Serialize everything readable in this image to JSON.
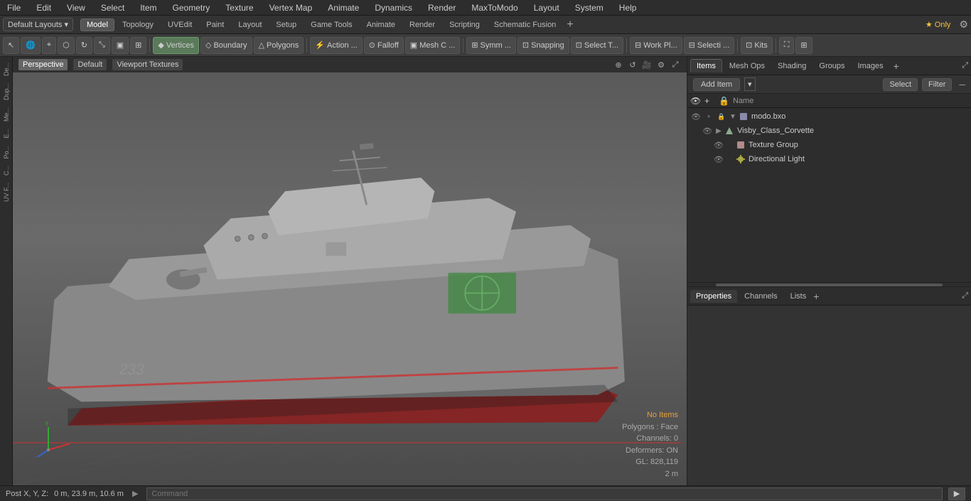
{
  "menu": {
    "items": [
      "File",
      "Edit",
      "View",
      "Select",
      "Item",
      "Geometry",
      "Texture",
      "Vertex Map",
      "Animate",
      "Dynamics",
      "Render",
      "MaxToModo",
      "Layout",
      "System",
      "Help"
    ]
  },
  "layout_bar": {
    "dropdown_label": "Default Layouts ▾",
    "tabs": [
      "Model",
      "Topology",
      "UVEdit",
      "Paint",
      "Layout",
      "Setup",
      "Game Tools",
      "Animate",
      "Render",
      "Scripting",
      "Schematic Fusion"
    ],
    "add_btn": "+",
    "star_label": "★ Only"
  },
  "toolbar": {
    "buttons": [
      {
        "id": "select-mode",
        "label": "",
        "icon": "⊹"
      },
      {
        "id": "action-center",
        "label": "",
        "icon": "⊕"
      },
      {
        "id": "transform-falloff",
        "label": "",
        "icon": "⬡"
      },
      {
        "id": "transform-move",
        "label": "",
        "icon": "✦"
      },
      {
        "id": "transform-rotate",
        "label": "",
        "icon": "↻"
      },
      {
        "id": "transform-scale",
        "label": "",
        "icon": "⤡"
      },
      {
        "id": "transform-type",
        "label": "",
        "icon": "▣"
      },
      {
        "id": "snapping",
        "label": "",
        "icon": "⊞"
      },
      {
        "id": "vertices-btn",
        "label": "Vertices",
        "icon": "◆"
      },
      {
        "id": "boundary-btn",
        "label": "Boundary",
        "icon": "◇"
      },
      {
        "id": "polygons-btn",
        "label": "Polygons",
        "icon": "▲"
      },
      {
        "id": "action-btn",
        "label": "Action ...",
        "icon": "⚡"
      },
      {
        "id": "falloff-btn",
        "label": "Falloff",
        "icon": "⊙"
      },
      {
        "id": "mesh-c-btn",
        "label": "Mesh C ...",
        "icon": "▣"
      },
      {
        "id": "symm-btn",
        "label": "Symm ...",
        "icon": "⊞"
      },
      {
        "id": "snapping-btn",
        "label": "Snapping",
        "icon": "⊡"
      },
      {
        "id": "select-t-btn",
        "label": "Select T...",
        "icon": "⊡"
      },
      {
        "id": "work-pl-btn",
        "label": "Work Pl...",
        "icon": "⊡"
      },
      {
        "id": "selecti-btn",
        "label": "Selecti ...",
        "icon": "⊡"
      },
      {
        "id": "kits-btn",
        "label": "Kits",
        "icon": "⊡"
      },
      {
        "id": "fullscreen-btn",
        "label": "",
        "icon": "⛶"
      },
      {
        "id": "layout-split-btn",
        "label": "",
        "icon": "⊞"
      }
    ]
  },
  "viewport": {
    "tabs": [
      "Perspective",
      "Default",
      "Viewport Textures"
    ],
    "active_tab": "Perspective",
    "status": {
      "no_items": "No Items",
      "polygons": "Polygons : Face",
      "channels": "Channels: 0",
      "deformers": "Deformers: ON",
      "gl": "GL: 828,119",
      "distance": "2 m"
    }
  },
  "left_sidebar": {
    "tabs": [
      "De...",
      "Dup...",
      "Me...",
      "E...",
      "Po...",
      "C...",
      "UV F..."
    ]
  },
  "right_panel": {
    "tabs": [
      "Items",
      "Mesh Ops",
      "Shading",
      "Groups",
      "Images"
    ],
    "active_tab": "Items",
    "add_item_label": "Add Item",
    "select_label": "Select",
    "filter_label": "Filter",
    "col_header": "Name",
    "tree": [
      {
        "id": "modo-bxo",
        "label": "modo.bxo",
        "indent": 0,
        "type": "mesh",
        "expanded": true
      },
      {
        "id": "visby-class",
        "label": "Visby_Class_Corvette",
        "indent": 1,
        "type": "mesh",
        "expanded": false
      },
      {
        "id": "texture-group",
        "label": "Texture Group",
        "indent": 2,
        "type": "texture"
      },
      {
        "id": "dir-light",
        "label": "Directional Light",
        "indent": 2,
        "type": "light"
      }
    ]
  },
  "properties_panel": {
    "tabs": [
      "Properties",
      "Channels",
      "Lists"
    ],
    "active_tab": "Properties",
    "add_btn": "+"
  },
  "status_bar": {
    "position_label": "Post X, Y, Z:",
    "position_value": "0 m, 23.9 m, 10.6 m",
    "command_placeholder": "Command",
    "go_btn": "▶"
  },
  "colors": {
    "bg_dark": "#2d2d2d",
    "bg_mid": "#3a3a3a",
    "bg_light": "#4a4a4a",
    "accent_blue": "#3a5a7a",
    "accent_orange": "#e8a040",
    "border": "#555555",
    "text_light": "#cccccc",
    "text_dim": "#999999"
  }
}
